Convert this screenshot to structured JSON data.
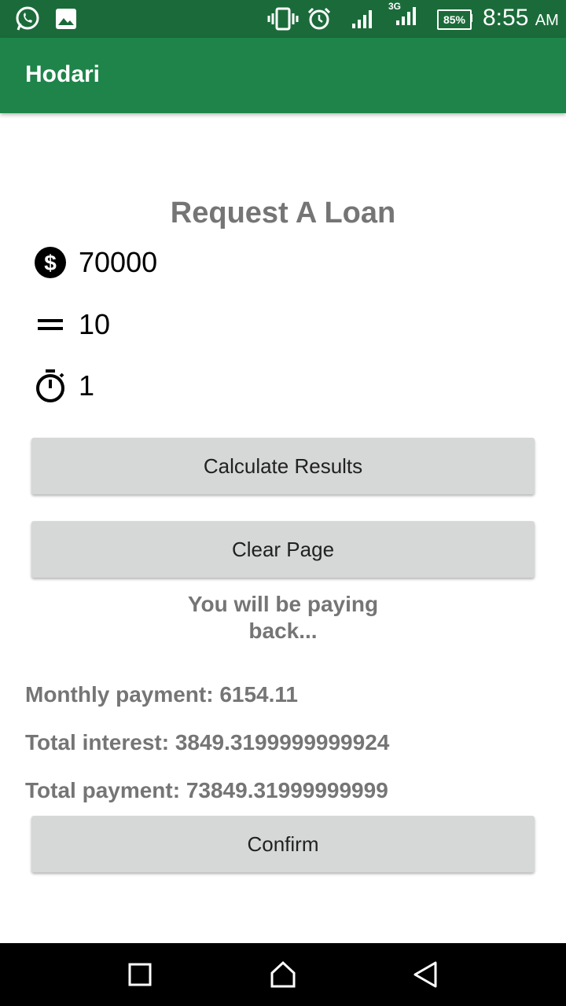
{
  "status_bar": {
    "battery": "85%",
    "time": "8:55",
    "ampm": "AM",
    "network": "3G",
    "icons": [
      "whatsapp-icon",
      "image-icon",
      "vibrate-icon",
      "alarm-icon",
      "signal-icon",
      "signal-3g-icon",
      "battery-icon"
    ]
  },
  "app_bar": {
    "title": "Hodari"
  },
  "form": {
    "heading": "Request A Loan",
    "amount": "70000",
    "rate": "10",
    "years": "1",
    "icons": [
      "dollar-icon",
      "equals-icon",
      "timer-icon"
    ]
  },
  "buttons": {
    "calculate": "Calculate Results",
    "clear": "Clear Page",
    "confirm": "Confirm"
  },
  "results": {
    "intro_line1": "You will be paying",
    "intro_line2": "back...",
    "monthly": "Monthly payment: 6154.11",
    "interest": "Total interest: 3849.3199999999924",
    "total": "Total payment: 73849.31999999999"
  },
  "nav_bar": {
    "icons": [
      "recents-icon",
      "home-icon",
      "back-icon"
    ]
  }
}
